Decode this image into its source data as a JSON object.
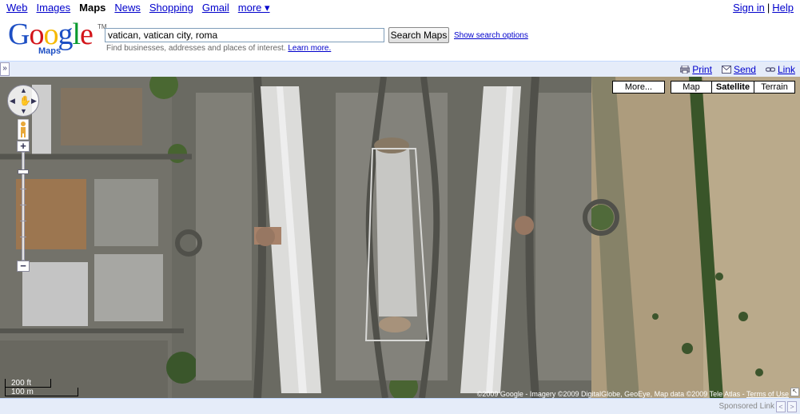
{
  "nav": {
    "items": [
      {
        "label": "Web",
        "active": false
      },
      {
        "label": "Images",
        "active": false
      },
      {
        "label": "Maps",
        "active": true
      },
      {
        "label": "News",
        "active": false
      },
      {
        "label": "Shopping",
        "active": false
      },
      {
        "label": "Gmail",
        "active": false
      },
      {
        "label": "more ▾",
        "active": false
      }
    ],
    "sign_in": "Sign in",
    "separator": "|",
    "help": "Help"
  },
  "logo": {
    "text": "Google",
    "sub": "Maps",
    "tm": "TM",
    "colors": [
      "#1d4fc4",
      "#d3151a",
      "#f6b901",
      "#1d4fc4",
      "#069a2e",
      "#d3151a"
    ]
  },
  "search": {
    "value": "vatican, vatican city, roma",
    "button": "Search Maps",
    "options_link": "Show search options",
    "hint": "Find businesses, addresses and places of interest.",
    "learn_more": "Learn more."
  },
  "toolbar": {
    "collapse": "»",
    "print": "Print",
    "send": "Send",
    "link": "Link"
  },
  "map": {
    "types": {
      "more": "More...",
      "map": "Map",
      "satellite": "Satellite",
      "terrain": "Terrain",
      "selected": "satellite"
    },
    "scale": {
      "ft": "200 ft",
      "m": "100 m"
    },
    "copyright": "©2009 Google - Imagery ©2009 DigitalGlobe, GeoEye, Map data ©2009 Tele Atlas -",
    "terms": "Terms of Use"
  },
  "footer": {
    "sponsored": "Sponsored Link",
    "prev": "<",
    "next": ">"
  }
}
